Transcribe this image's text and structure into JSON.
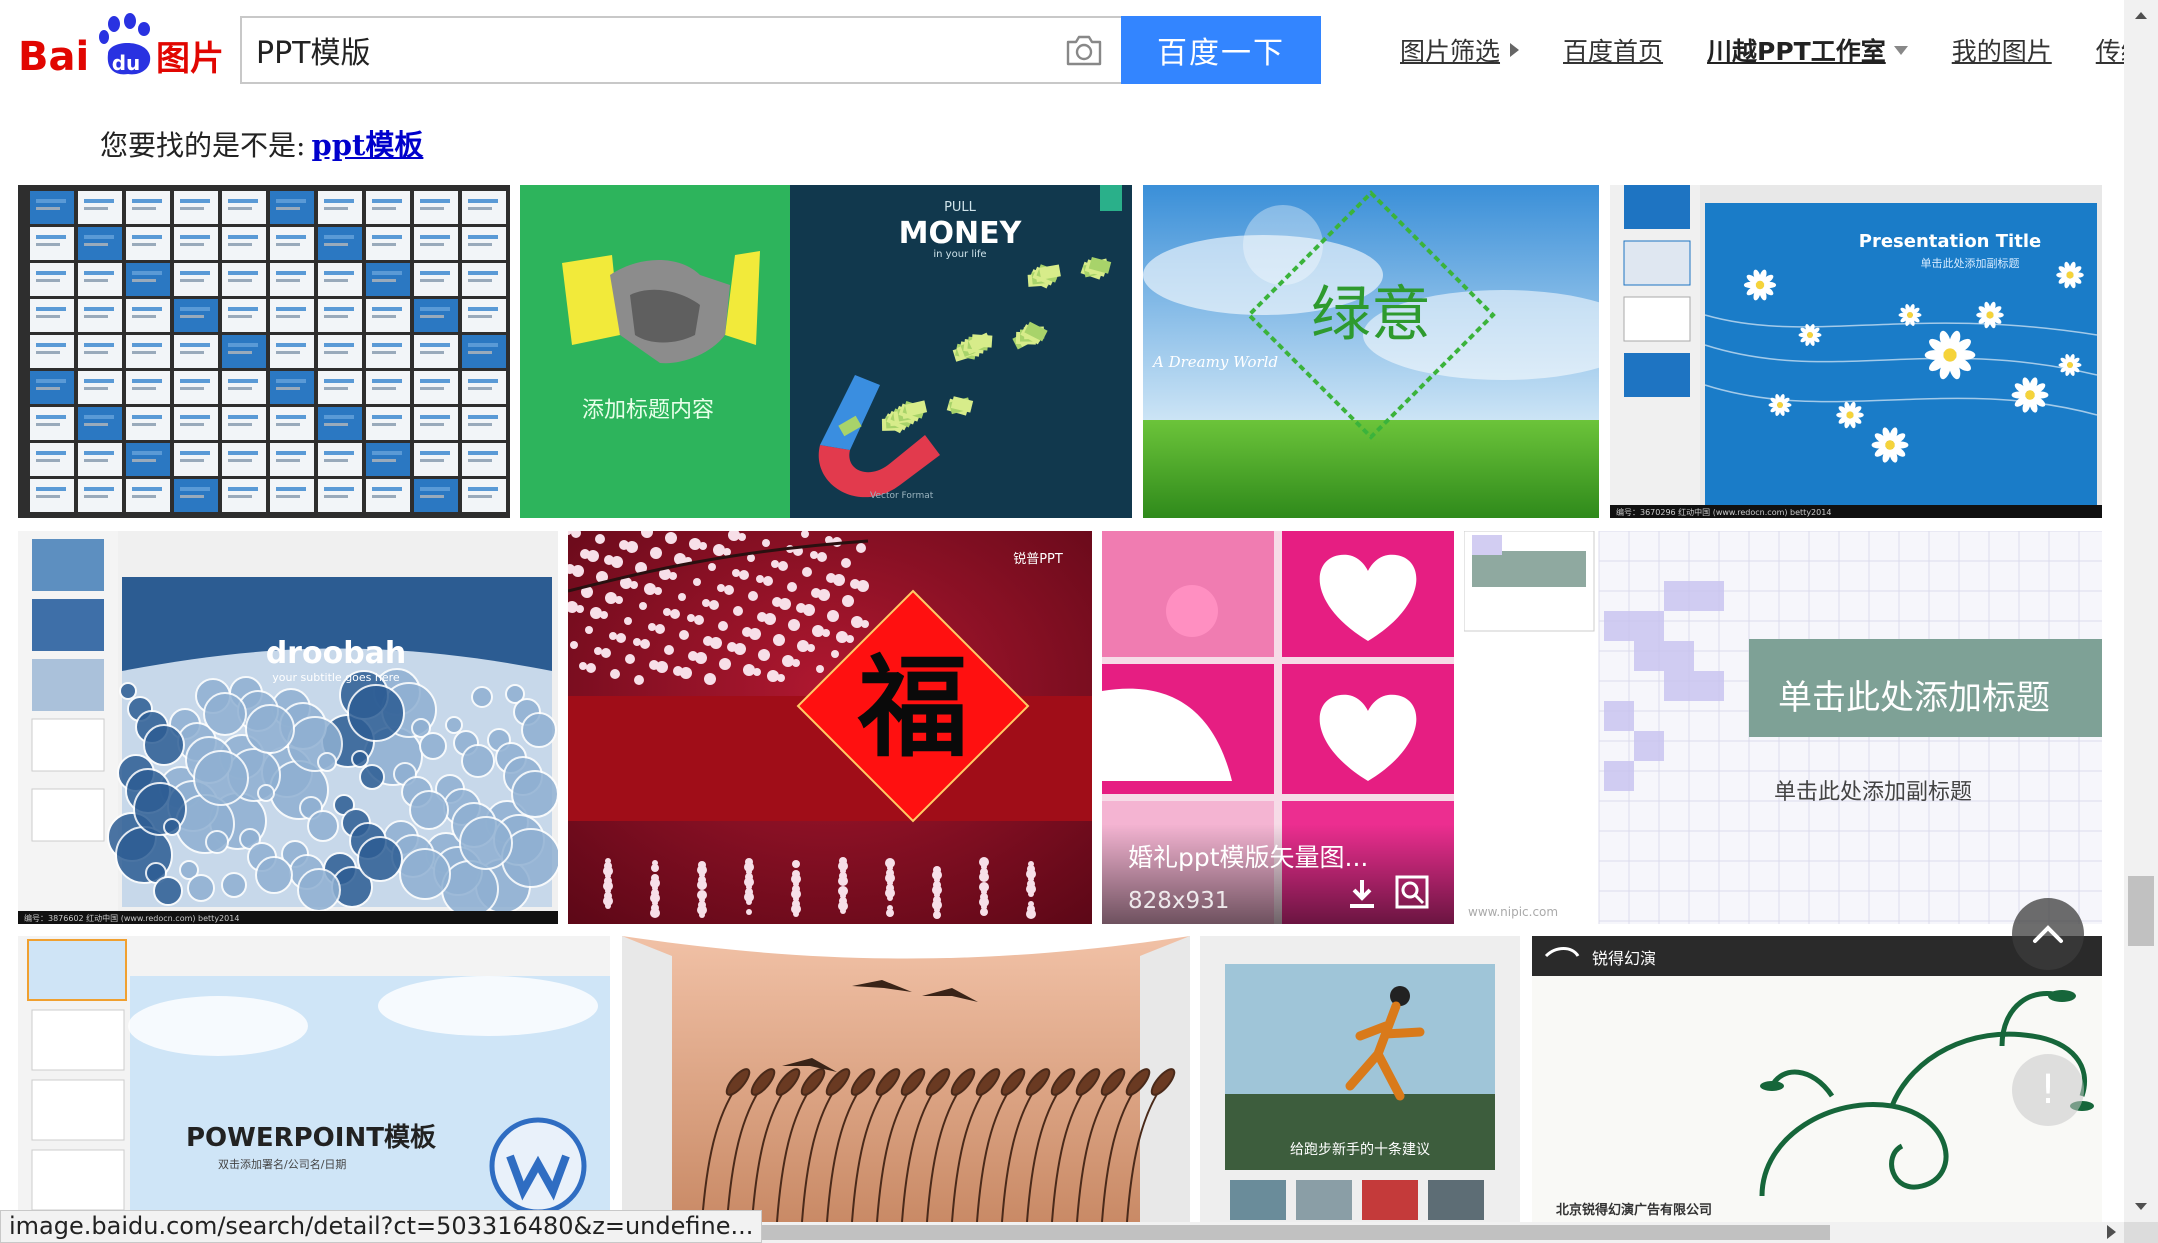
{
  "header": {
    "logo": {
      "prefix": "Bai",
      "du": "du",
      "suffix": "图片"
    },
    "search": {
      "value": "PPT模版",
      "placeholder": ""
    },
    "search_button": "百度一下",
    "nav": [
      {
        "label": "图片筛选",
        "marker": "triangle-right"
      },
      {
        "label": "百度首页",
        "marker": ""
      },
      {
        "label": "川越PPT工作室",
        "marker": "triangle-down",
        "bold": true
      },
      {
        "label": "我的图片",
        "marker": ""
      },
      {
        "label": "传统翻页版",
        "marker": ""
      }
    ]
  },
  "suggestion": {
    "prefix": "您要找的是不是:",
    "link": "ppt模板"
  },
  "tiles": {
    "money": {
      "pull": "PULL",
      "money": "MONEY",
      "sub": "in your life",
      "caption": "添加标题内容",
      "vector": "Vector Format"
    },
    "green": {
      "title": "绿意",
      "script": "A Dreamy World"
    },
    "presentation": {
      "title": "Presentation Title",
      "sub": "单击此处添加副标题",
      "footer": "编号：3670296   红动中国 (www.redocn.com)   betty2014"
    },
    "droobah": {
      "title": "droobah",
      "sub": "your subtitle goes here",
      "footer": "编号：3876602   红动中国 (www.redocn.com)   betty2014"
    },
    "fu": {
      "char": "福",
      "brand": "锐普PPT"
    },
    "wedding": {
      "title": "婚礼ppt模版矢量图...",
      "size": "828x931",
      "watermark": "www.nipic.com"
    },
    "mosaic": {
      "title": "单击此处添加标题",
      "sub": "单击此处添加副标题"
    },
    "powerpoint": {
      "title": "POWERPOINT模板",
      "sub": "双击添加署名/公司名/日期"
    },
    "runner": {
      "caption": "给跑步新手的十条建议"
    },
    "swirl": {
      "brand": "锐得幻演",
      "footer": "北京锐得幻演广告有限公司"
    }
  },
  "status_bar": {
    "url": "image.baidu.com/search/detail?ct=503316480&z=undefine..."
  },
  "colors": {
    "brand_blue": "#3385ff",
    "baidu_red": "#e10601",
    "link_blue": "#0000cc"
  }
}
